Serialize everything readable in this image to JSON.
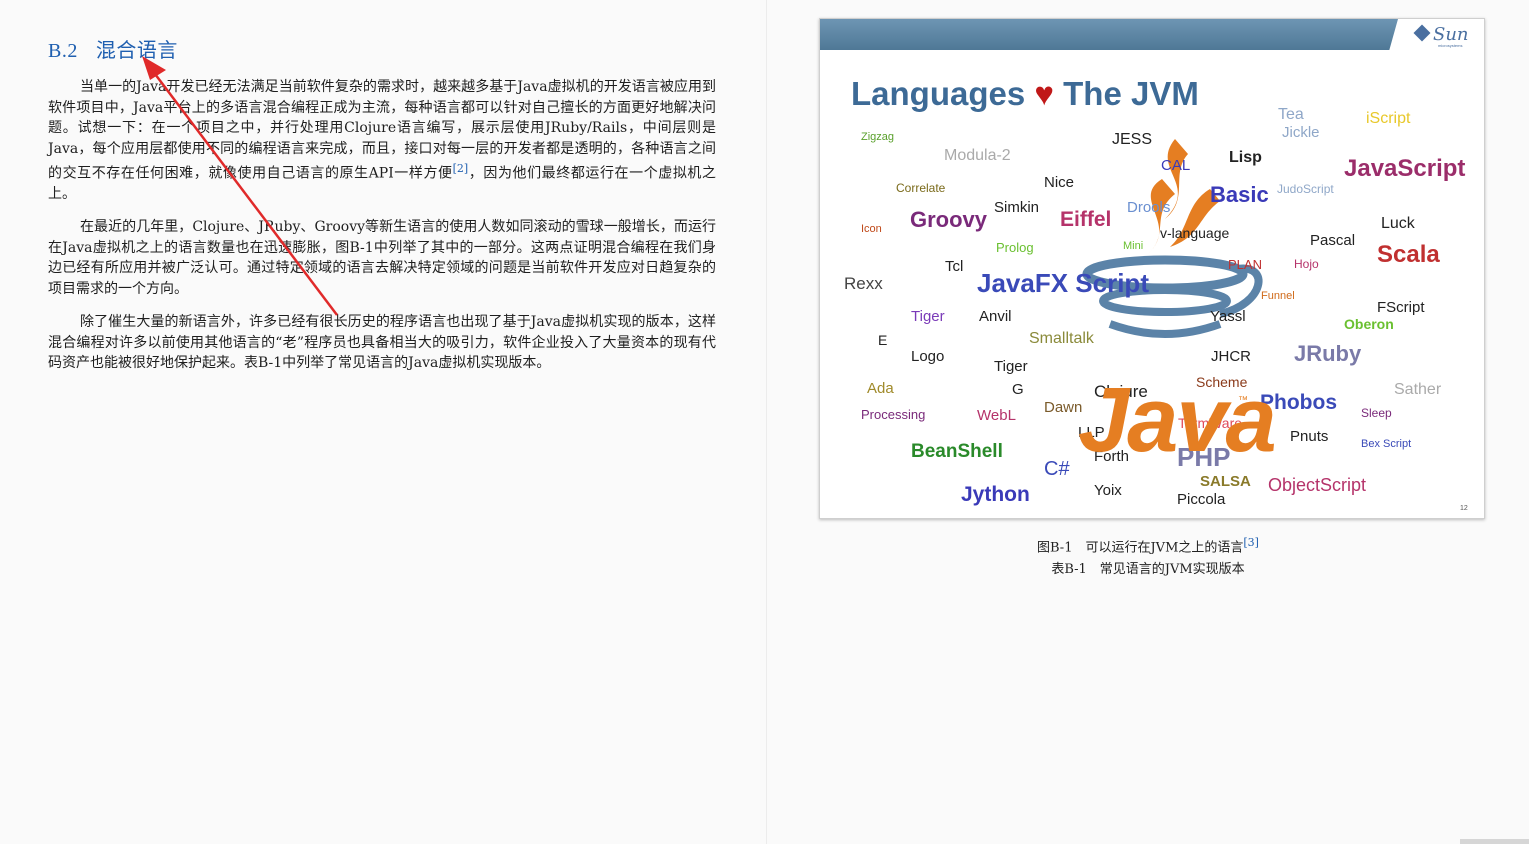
{
  "section": {
    "number": "B.2",
    "title": "混合语言"
  },
  "paragraphs": [
    {
      "text_before": "当单一的Java开发已经无法满足当前软件复杂的需求时，越来越多基于Java虚拟机的开发语言被应用到软件项目中，Java平台上的多语言混合编程正成为主流，每种语言都可以针对自己擅长的方面更好地解决问题。试想一下：在一个项目之中，并行处理用Clojure语言编写，展示层使用JRuby/Rails，中间层则是Java，每个应用层都使用不同的编程语言来完成，而且，接口对每一层的开发者都是透明的，各种语言之间的交互不存在任何困难，就像使用自己语言的原生API一样方便",
      "ref": "[2]",
      "text_after": "，因为他们最终都运行在一个虚拟机之上。"
    },
    {
      "text": "在最近的几年里，Clojure、JRuby、Groovy等新生语言的使用人数如同滚动的雪球一般增长，而运行在Java虚拟机之上的语言数量也在迅速膨胀，图B-1中列举了其中的一部分。这两点证明混合编程在我们身边已经有所应用并被广泛认可。通过特定领域的语言去解决特定领域的问题是当前软件开发应对日趋复杂的项目需求的一个方向。"
    },
    {
      "text": "除了催生大量的新语言外，许多已经有很长历史的程序语言也出现了基于Java虚拟机实现的版本，这样混合编程对许多以前使用其他语言的“老”程序员也具备相当大的吸引力，软件企业投入了大量资本的现有代码资产也能被很好地保护起来。表B-1中列举了常见语言的Java虚拟机实现版本。"
    }
  ],
  "figure": {
    "slide_title_left": "Languages",
    "slide_title_heart": "♥",
    "slide_title_right": "The JVM",
    "logo_text": "Sun",
    "logo_sub": "microsystems",
    "java_wordmark": "Java",
    "trademark": "™",
    "slide_number": "12",
    "languages": [
      "Tea",
      "iScript",
      "Zigzag",
      "JESS",
      "Jickle",
      "Modula-2",
      "Lisp",
      "CAL",
      "JavaScript",
      "Correlate",
      "Nice",
      "JudoScript",
      "Simkin",
      "Drools",
      "Basic",
      "Icon",
      "Groovy",
      "Eiffel",
      "Luck",
      "v-language",
      "Pascal",
      "Prolog",
      "Mini",
      "Tcl",
      "PLAN",
      "Hojo",
      "Scala",
      "Rexx",
      "JavaFX Script",
      "Funnel",
      "FScript",
      "Tiger",
      "Anvil",
      "Yassl",
      "Oberon",
      "E",
      "Smalltalk",
      "Logo",
      "Tiger",
      "JHCR",
      "JRuby",
      "Ada",
      "G",
      "Clojure",
      "Scheme",
      "Sather",
      "Processing",
      "WebL",
      "Dawn",
      "TermWare",
      "Phobos",
      "Sleep",
      "LLP",
      "Pnuts",
      "Bex Script",
      "BeanShell",
      "Forth",
      "PHP",
      "C#",
      "SALSA",
      "ObjectScript",
      "Jython",
      "Yoix",
      "Piccola"
    ]
  },
  "captions": {
    "figure": "图B-1　可以运行在JVM之上的语言",
    "figure_ref": "[3]",
    "table": "表B-1　常见语言的JVM实现版本"
  },
  "colors": {
    "heading": "#1f5fb0",
    "annotation_arrow": "#e02a2a"
  }
}
